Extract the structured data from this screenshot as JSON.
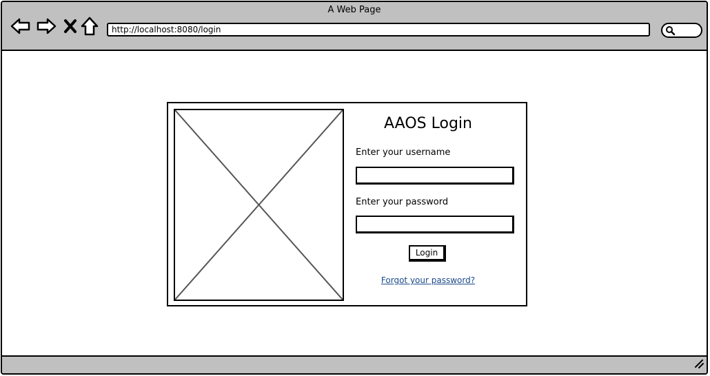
{
  "window": {
    "title": "A Web Page"
  },
  "toolbar": {
    "icons": [
      "back-arrow-icon",
      "forward-arrow-icon",
      "close-x-icon",
      "home-icon",
      "search-icon"
    ],
    "url": "http://localhost:8080/login"
  },
  "login": {
    "title": "AAOS Login",
    "username_label": "Enter your username",
    "username_value": "",
    "password_label": "Enter your password",
    "password_value": "",
    "button_label": "Login",
    "forgot_link": "Forgot your password?"
  },
  "colors": {
    "chrome": "#c0c0c0",
    "link": "#1a4a8a",
    "border": "#000000"
  }
}
